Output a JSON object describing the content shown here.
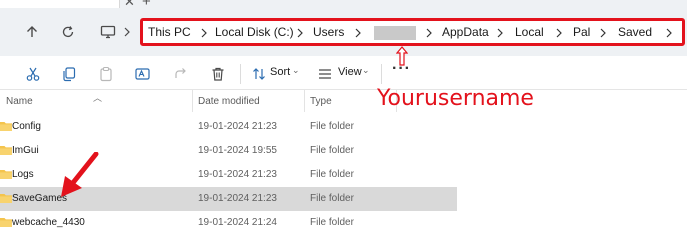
{
  "tabstrip": {
    "close_glyph": "✕",
    "new_tab_glyph": "+"
  },
  "navbar": {
    "up_icon": "arrow-up-icon",
    "refresh_icon": "refresh-icon",
    "this_pc_icon": "monitor-icon",
    "breadcrumbs": [
      "This PC",
      "Local Disk (C:)",
      "Users",
      "",
      "AppData",
      "Local",
      "Pal",
      "Saved"
    ],
    "redacted_segment_color": "#c9c9c9",
    "expand_icon": "chevron-right-icon"
  },
  "toolbar": {
    "cut_icon": "scissors-icon",
    "copy_icon": "copy-icon",
    "paste_icon": "clipboard-icon",
    "rename_icon": "rename-icon",
    "share_icon": "share-icon",
    "delete_icon": "trash-icon",
    "sort_label": "Sort",
    "view_label": "View",
    "more_label": "···"
  },
  "columns": {
    "name": "Name",
    "date_modified": "Date modified",
    "type": "Type"
  },
  "files": [
    {
      "name": "Config",
      "date": "19-01-2024 21:23",
      "type": "File folder",
      "selected": false
    },
    {
      "name": "ImGui",
      "date": "19-01-2024 19:55",
      "type": "File folder",
      "selected": false
    },
    {
      "name": "Logs",
      "date": "19-01-2024 21:23",
      "type": "File folder",
      "selected": false
    },
    {
      "name": "SaveGames",
      "date": "19-01-2024 21:23",
      "type": "File folder",
      "selected": true
    },
    {
      "name": "webcache_4430",
      "date": "19-01-2024 21:24",
      "type": "File folder",
      "selected": false
    }
  ],
  "annotation": {
    "label": "Yourusername",
    "color": "#e3121c",
    "arrow_icon": "red-arrow-icon"
  },
  "colors": {
    "accent": "#e3121c",
    "folder": "#f4c44d",
    "selected_row": "#d9d9d9",
    "navbar_bg": "#eef1f4"
  }
}
